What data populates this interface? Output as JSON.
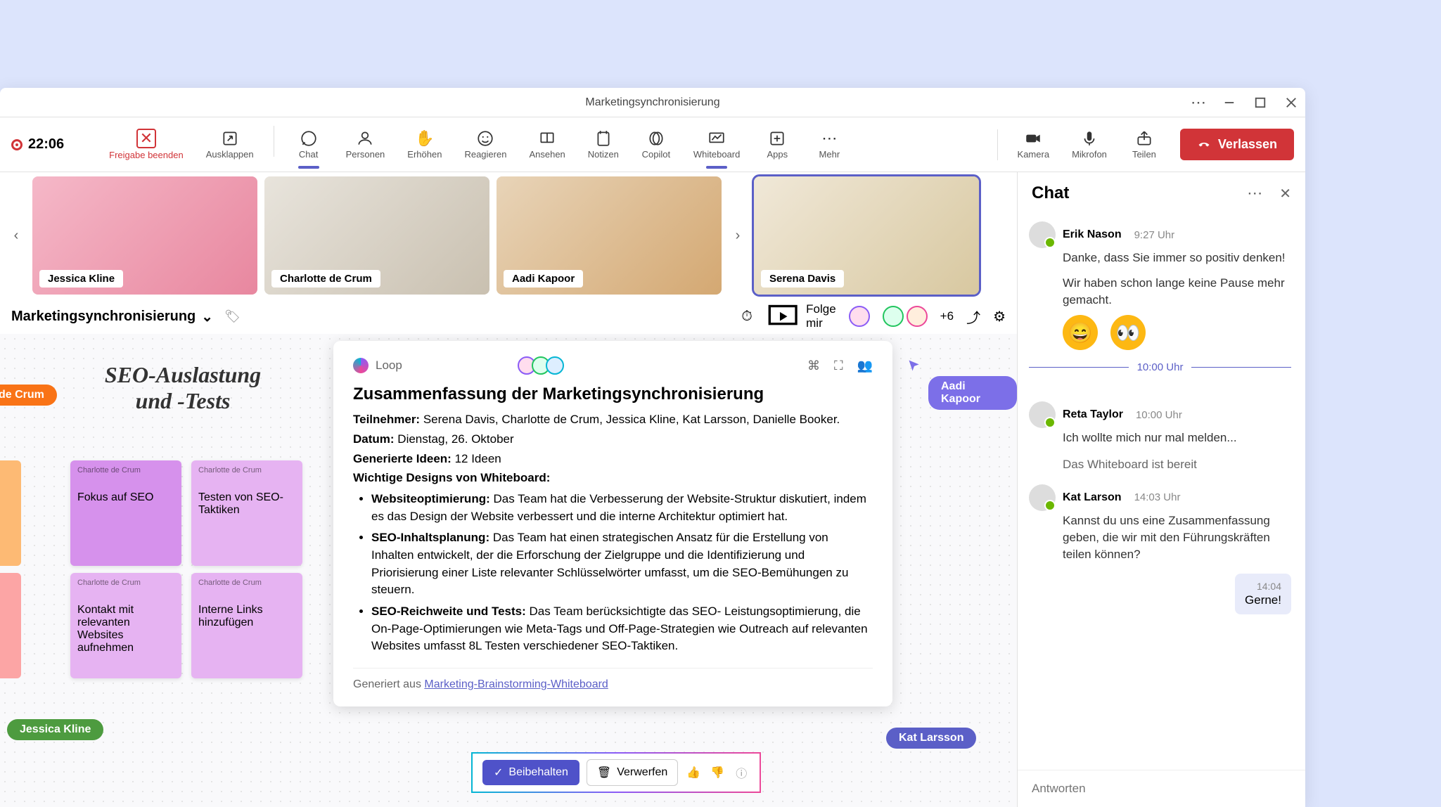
{
  "window": {
    "title": "Marketingsynchronisierung"
  },
  "recTime": "22:06",
  "toolbar": {
    "stopShare": "Freigabe beenden",
    "popout": "Ausklappen",
    "chat": "Chat",
    "people": "Personen",
    "raise": "Erhöhen",
    "react": "Reagieren",
    "view": "Ansehen",
    "notes": "Notizen",
    "copilot": "Copilot",
    "whiteboard": "Whiteboard",
    "apps": "Apps",
    "more": "Mehr",
    "camera": "Kamera",
    "mic": "Mikrofon",
    "share": "Teilen",
    "leave": "Verlassen"
  },
  "participants": [
    {
      "name": "Jessica Kline"
    },
    {
      "name": "Charlotte de Crum"
    },
    {
      "name": "Aadi Kapoor"
    },
    {
      "name": "Serena Davis"
    }
  ],
  "wb": {
    "title": "Marketingsynchronisierung",
    "follow": "Folge mir",
    "extra": "+6"
  },
  "stickyTitle": "SEO-Auslastung und -Tests",
  "stickies": [
    {
      "author": "Charlotte de Crum",
      "text": "Fokus auf SEO"
    },
    {
      "author": "Charlotte de Crum",
      "text": "Testen von SEO-Taktiken"
    },
    {
      "author": "Charlotte de Crum",
      "text": "Kontakt mit relevanten Websites aufnehmen"
    },
    {
      "author": "Charlotte de Crum",
      "text": "Interne Links hinzufügen"
    }
  ],
  "cursors": {
    "decrum": "de Crum",
    "jkline": "Jessica Kline",
    "akapoor": "Aadi Kapoor",
    "klarsson": "Kat Larsson"
  },
  "loop": {
    "brand": "Loop",
    "heading": "Zusammenfassung der Marketingsynchronisierung",
    "attendeesLabel": "Teilnehmer:",
    "attendees": "Serena Davis, Charlotte de Crum, Jessica Kline, Kat Larsson, Danielle Booker.",
    "dateLabel": "Datum:",
    "date": "Dienstag, 26. Oktober",
    "ideasLabel": "Generierte Ideen:",
    "ideas": "12 Ideen",
    "designsLabel": "Wichtige Designs von Whiteboard:",
    "b1t": "Websiteoptimierung:",
    "b1": "Das Team hat die Verbesserung der Website-Struktur diskutiert, indem es das Design der Website verbessert und die interne Architektur optimiert hat.",
    "b2t": "SEO-Inhaltsplanung:",
    "b2": "Das Team hat einen strategischen Ansatz für die Erstellung von Inhalten entwickelt, der die Erforschung der Zielgruppe und die Identifizierung und Priorisierung einer Liste relevanter Schlüsselwörter umfasst, um die SEO-Bemühungen zu steuern.",
    "b3t": "SEO-Reichweite und Tests:",
    "b3": "Das Team berücksichtigte das SEO- Leistungsoptimierung, die On-Page-Optimierungen wie Meta-Tags und Off-Page-Strategien wie Outreach auf relevanten Websites umfasst 8L Testen verschiedener SEO-Taktiken.",
    "genFrom": "Generiert aus ",
    "genLink": "Marketing-Brainstorming-Whiteboard"
  },
  "actions": {
    "keep": "Beibehalten",
    "discard": "Verwerfen"
  },
  "chat": {
    "title": "Chat",
    "m0name": "Erik Nason",
    "m0time": "9:27 Uhr",
    "m0t1": "Danke, dass Sie immer so positiv denken!",
    "m0t2": "Wir haben schon lange keine Pause mehr gemacht.",
    "divider": "10:00 Uhr",
    "m1name": "Reta Taylor",
    "m1time": "10:00 Uhr",
    "m1t1": "Ich wollte mich nur mal melden...",
    "m1t2": "Das Whiteboard ist bereit",
    "m2name": "Kat Larson",
    "m2time": "14:03 Uhr",
    "m2t1": "Kannst du uns eine Zusammenfassung geben, die wir mit den Führungskräften teilen können?",
    "ownTime": "14:04",
    "ownText": "Gerne!",
    "placeholder": "Antworten"
  }
}
